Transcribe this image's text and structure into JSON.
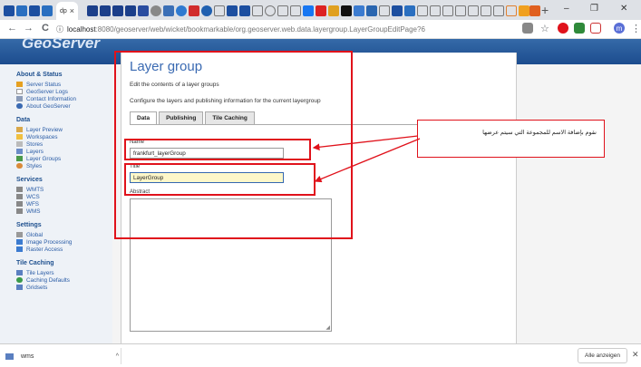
{
  "browser": {
    "active_tab_label": "dp",
    "tab_close": "×",
    "new_tab": "+",
    "minimize": "–",
    "maximize": "❐",
    "close": "✕",
    "url_host": "localhost",
    "url_path": ":8080/geoserver/web/wicket/bookmarkable/org.geoserver.web.data.layergroup.LayerGroupEditPage?6",
    "back": "←",
    "forward": "→",
    "reload": "C",
    "info": "ⓘ",
    "star": "☆",
    "menu": "⋮",
    "profile_initial": "m"
  },
  "banner": {
    "logo": "GeoServer"
  },
  "sidebar": {
    "sections": [
      {
        "title": "About & Status",
        "items": [
          "Server Status",
          "GeoServer Logs",
          "Contact Information",
          "About GeoServer"
        ]
      },
      {
        "title": "Data",
        "items": [
          "Layer Preview",
          "Workspaces",
          "Stores",
          "Layers",
          "Layer Groups",
          "Styles"
        ]
      },
      {
        "title": "Services",
        "items": [
          "WMTS",
          "WCS",
          "WFS",
          "WMS"
        ]
      },
      {
        "title": "Settings",
        "items": [
          "Global",
          "Image Processing",
          "Raster Access"
        ]
      },
      {
        "title": "Tile Caching",
        "items": [
          "Tile Layers",
          "Caching Defaults",
          "Gridsets"
        ]
      }
    ]
  },
  "page": {
    "title": "Layer group",
    "desc1": "Edit the contents of a layer groups",
    "desc2": "Configure the layers and publishing information for the current layergroup",
    "tabs": [
      "Data",
      "Publishing",
      "Tile Caching"
    ],
    "name_label": "Name",
    "name_value": "frankfurt_layerGroup",
    "title_label": "Title",
    "title_value": "LayerGroup",
    "abstract_label": "Abstract",
    "resize_glyph": "◢"
  },
  "callout": {
    "text": "نقوم بإضافة الاسم للمجموعة التي سيتم عرضها"
  },
  "downloads": {
    "file": "wms",
    "chevron": "^",
    "show_all": "Alle anzeigen",
    "close": "✕"
  },
  "colors": {
    "annotation_red": "#e0121b",
    "banner_blue": "#1c4c8e",
    "link_blue": "#2a5ca6"
  }
}
